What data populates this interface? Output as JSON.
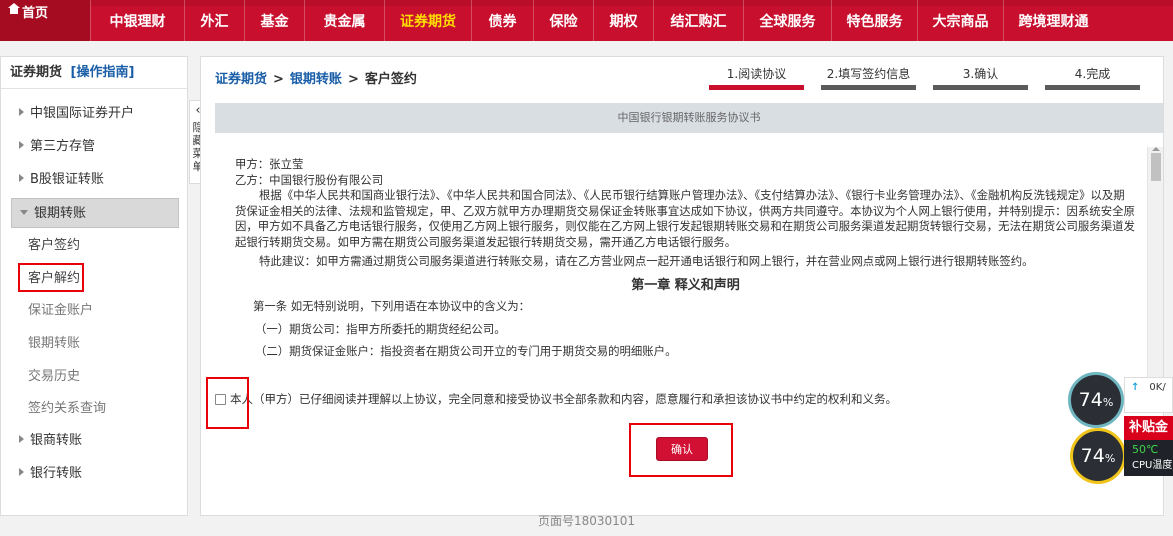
{
  "topnav": {
    "home": "首页",
    "items": [
      {
        "label": "中银理财",
        "active": false
      },
      {
        "label": "外汇",
        "active": false
      },
      {
        "label": "基金",
        "active": false
      },
      {
        "label": "贵金属",
        "active": false
      },
      {
        "label": "证券期货",
        "active": true
      },
      {
        "label": "债券",
        "active": false
      },
      {
        "label": "保险",
        "active": false
      },
      {
        "label": "期权",
        "active": false
      },
      {
        "label": "结汇购汇",
        "active": false
      },
      {
        "label": "全球服务",
        "active": false
      },
      {
        "label": "特色服务",
        "active": false
      },
      {
        "label": "大宗商品",
        "active": false
      },
      {
        "label": "跨境理财通",
        "active": false
      }
    ]
  },
  "sidebar": {
    "title": "证券期货",
    "guide": "[操作指南]",
    "groups": [
      {
        "label": "中银国际证券开户"
      },
      {
        "label": "第三方存管"
      },
      {
        "label": "B股银证转账"
      },
      {
        "label": "银期转账",
        "open": true,
        "children": [
          "客户签约",
          "客户解约",
          "保证金账户",
          "银期转账",
          "交易历史",
          "签约关系查询"
        ]
      },
      {
        "label": "银商转账"
      },
      {
        "label": "银行转账"
      }
    ]
  },
  "collapse": {
    "label": "隐藏菜单"
  },
  "main": {
    "breadcrumb": [
      "证券期货",
      "银期转账",
      "客户签约"
    ],
    "steps": [
      "1.阅读协议",
      "2.填写签约信息",
      "3.确认",
      "4.完成"
    ],
    "doc_title": "中国银行银期转账服务协议书",
    "party_a": "甲方：张立莹",
    "party_b": "乙方：中国银行股份有限公司",
    "para1": "根据《中华人民共和国商业银行法》、《中华人民共和国合同法》、《人民币银行结算账户管理办法》、《支付结算办法》、《银行卡业务管理办法》、《金融机构反洗钱规定》以及期货保证金相关的法律、法规和监管规定，甲、乙双方就甲方办理期货交易保证金转账事宜达成如下协议，供两方共同遵守。本协议为个人网上银行使用，并特别提示：因系统安全原因，甲方如不具备乙方电话银行服务，仅使用乙方网上银行服务，则仅能在乙方网上银行发起银期转账交易和在期货公司服务渠道发起期货转银行交易，无法在期货公司服务渠道发起银行转期货交易。如甲方需在期货公司服务渠道发起银行转期货交易，需开通乙方电话银行服务。",
    "para2": "特此建议：如甲方需通过期货公司服务渠道进行转账交易，请在乙方营业网点一起开通电话银行和网上银行，并在营业网点或网上银行进行银期转账签约。",
    "chapter": "第一章 释义和声明",
    "art1": "第一条 如无特别说明，下列用语在本协议中的含义为：",
    "item1": "（一）期货公司：指甲方所委托的期货经纪公司。",
    "item2": "（二）期货保证金账户：指投资者在期货公司开立的专门用于期货交易的明细账户。",
    "agree": "本人（甲方）已仔细阅读并理解以上协议，完全同意和接受协议书全部条款和内容，愿意履行和承担该协议书中约定的权利和义务。",
    "confirm": "确认"
  },
  "footer": "页面号18030101",
  "widget": {
    "gauge1": "74",
    "gauge2": "74",
    "pct": "%",
    "net": "0",
    "net_unit": "K/",
    "subsidy": "补贴金",
    "temp": "50℃",
    "cpu": "CPU温度"
  }
}
